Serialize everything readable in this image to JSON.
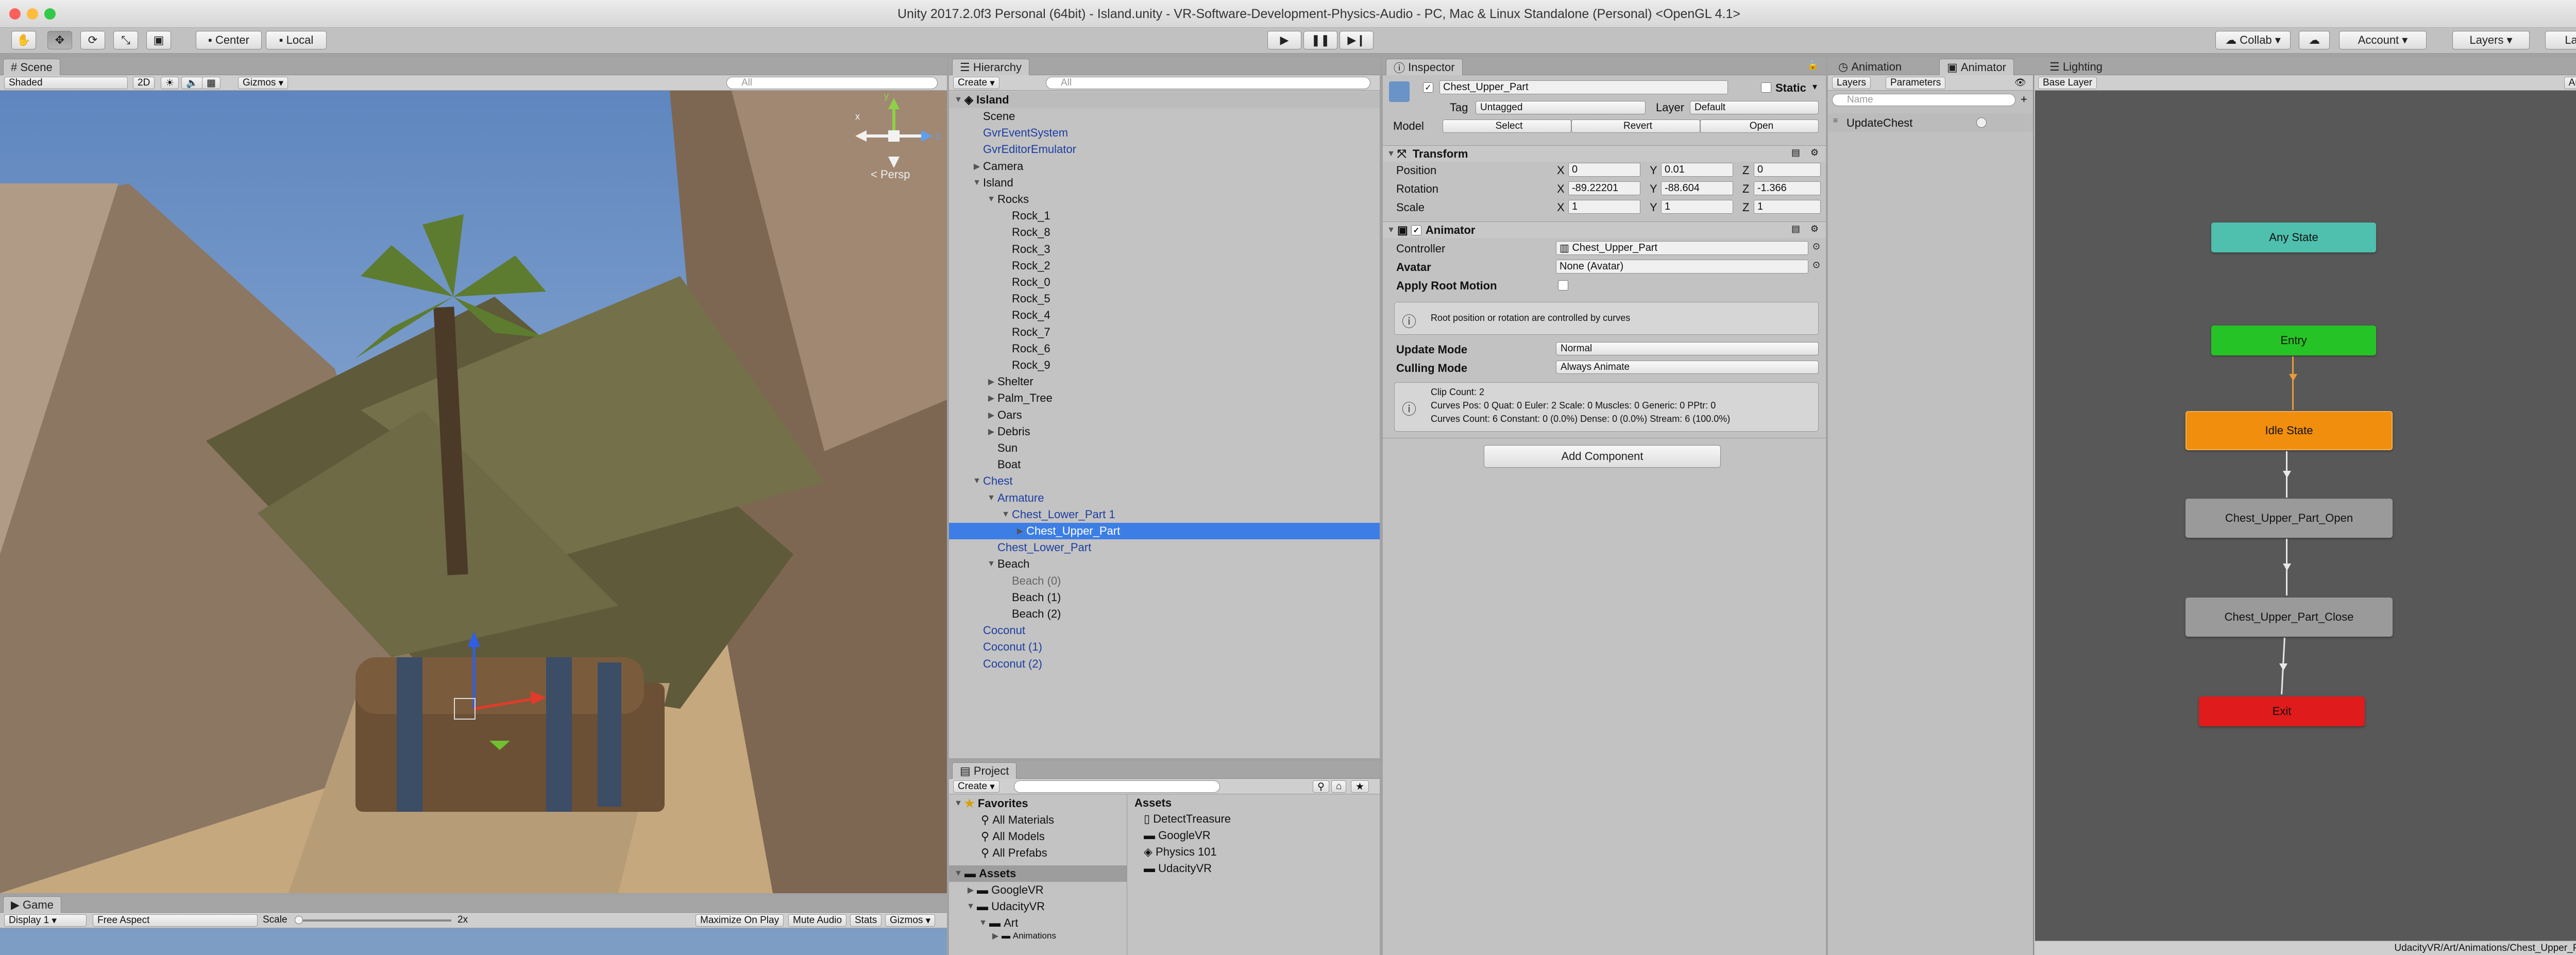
{
  "window": {
    "title": "Unity 2017.2.0f3 Personal (64bit) - Island.unity - VR-Software-Development-Physics-Audio - PC, Mac & Linux Standalone (Personal) <OpenGL 4.1>"
  },
  "toolbar": {
    "pivot": "Center",
    "space": "Local",
    "collab": "Collab",
    "account": "Account",
    "layers": "Layers",
    "layout": "Layout"
  },
  "scene": {
    "tab": "Scene",
    "shading": "Shaded",
    "mode_2d": "2D",
    "gizmos": "Gizmos",
    "search_placeholder": "All",
    "persp": "Persp",
    "axes": {
      "x": "x",
      "y": "y",
      "z": "z"
    }
  },
  "game": {
    "tab": "Game",
    "display": "Display 1",
    "aspect": "Free Aspect",
    "scale_label": "Scale",
    "scale_value": "2x",
    "maximize": "Maximize On Play",
    "mute": "Mute Audio",
    "stats": "Stats",
    "gizmos": "Gizmos"
  },
  "hierarchy": {
    "tab": "Hierarchy",
    "create": "Create",
    "search_placeholder": "All",
    "scene_root": "Island",
    "items": [
      {
        "label": "Scene",
        "color": "#111111"
      },
      {
        "label": "GvrEventSystem",
        "color": "#1d3ea0"
      },
      {
        "label": "GvrEditorEmulator",
        "color": "#1d3ea0"
      },
      {
        "label": "Camera",
        "color": "#111111"
      },
      {
        "label": "Island",
        "color": "#111111"
      },
      {
        "label": "Rocks",
        "color": "#111111"
      },
      {
        "label": "Rock_1",
        "color": "#111111"
      },
      {
        "label": "Rock_8",
        "color": "#111111"
      },
      {
        "label": "Rock_3",
        "color": "#111111"
      },
      {
        "label": "Rock_2",
        "color": "#111111"
      },
      {
        "label": "Rock_0",
        "color": "#111111"
      },
      {
        "label": "Rock_5",
        "color": "#111111"
      },
      {
        "label": "Rock_4",
        "color": "#111111"
      },
      {
        "label": "Rock_7",
        "color": "#111111"
      },
      {
        "label": "Rock_6",
        "color": "#111111"
      },
      {
        "label": "Rock_9",
        "color": "#111111"
      },
      {
        "label": "Shelter",
        "color": "#111111"
      },
      {
        "label": "Palm_Tree",
        "color": "#111111"
      },
      {
        "label": "Oars",
        "color": "#111111"
      },
      {
        "label": "Debris",
        "color": "#111111"
      },
      {
        "label": "Sun",
        "color": "#111111"
      },
      {
        "label": "Boat",
        "color": "#111111"
      },
      {
        "label": "Chest",
        "color": "#1d3ea0"
      },
      {
        "label": "Armature",
        "color": "#1d3ea0"
      },
      {
        "label": "Chest_Lower_Part 1",
        "color": "#1d3ea0"
      },
      {
        "label": "Chest_Upper_Part",
        "color": "#9bbdf2"
      },
      {
        "label": "Chest_Lower_Part",
        "color": "#1d3ea0"
      },
      {
        "label": "Beach",
        "color": "#111111"
      },
      {
        "label": "Beach (0)",
        "color": "#666666"
      },
      {
        "label": "Beach (1)",
        "color": "#111111"
      },
      {
        "label": "Beach (2)",
        "color": "#111111"
      },
      {
        "label": "Coconut",
        "color": "#1d3ea0"
      },
      {
        "label": "Coconut (1)",
        "color": "#1d3ea0"
      },
      {
        "label": "Coconut (2)",
        "color": "#1d3ea0"
      }
    ]
  },
  "project": {
    "tab": "Project",
    "create": "Create",
    "favorites": "Favorites",
    "favorite_items": [
      "All Materials",
      "All Models",
      "All Prefabs"
    ],
    "assets_root": "Assets",
    "tree": [
      "GoogleVR",
      "UdacityVR",
      "Art",
      "Animations"
    ],
    "assets_header": "Assets",
    "asset_items": [
      "DetectTreasure",
      "GoogleVR",
      "Physics 101",
      "UdacityVR"
    ]
  },
  "inspector": {
    "tab": "Inspector",
    "object_name": "Chest_Upper_Part",
    "static_label": "Static",
    "tag_label": "Tag",
    "tag_value": "Untagged",
    "layer_label": "Layer",
    "layer_value": "Default",
    "model_label": "Model",
    "select": "Select",
    "revert": "Revert",
    "open": "Open",
    "transform": {
      "title": "Transform",
      "position_label": "Position",
      "position": {
        "x": "0",
        "y": "0.01",
        "z": "0"
      },
      "rotation_label": "Rotation",
      "rotation": {
        "x": "-89.22201",
        "y": "-88.604",
        "z": "-1.366"
      },
      "scale_label": "Scale",
      "scale": {
        "x": "1",
        "y": "1",
        "z": "1"
      },
      "x": "X",
      "y": "Y",
      "z": "Z"
    },
    "animator": {
      "title": "Animator",
      "controller_label": "Controller",
      "controller_value": "Chest_Upper_Part",
      "avatar_label": "Avatar",
      "avatar_value": "None (Avatar)",
      "root_motion_label": "Apply Root Motion",
      "root_motion_note": "Root position or rotation are controlled by curves",
      "update_mode_label": "Update Mode",
      "update_mode_value": "Normal",
      "culling_mode_label": "Culling Mode",
      "culling_mode_value": "Always Animate",
      "clip_info": [
        "Clip Count: 2",
        "Curves Pos: 0 Quat: 0 Euler: 2 Scale: 0 Muscles: 0 Generic: 0 PPtr: 0",
        "Curves Count: 6 Constant: 0 (0.0%) Dense: 0 (0.0%) Stream: 6 (100.0%)"
      ]
    },
    "add_component": "Add Component"
  },
  "animator_window": {
    "tabs": [
      "Animation",
      "Animator",
      "Lighting"
    ],
    "layers_tab": "Layers",
    "parameters_tab": "Parameters",
    "search_placeholder": "Name",
    "parameters": [
      "UpdateChest"
    ],
    "base_layer": "Base Layer",
    "auto_live_link": "Auto Live Link",
    "states": [
      {
        "label": "Any State",
        "color": "#4fbfae"
      },
      {
        "label": "Entry",
        "color": "#25c325"
      },
      {
        "label": "Idle State",
        "color": "#f18e0e"
      },
      {
        "label": "Chest_Upper_Part_Open",
        "color": "#9a9a9a"
      },
      {
        "label": "Chest_Upper_Part_Close",
        "color": "#9a9a9a"
      },
      {
        "label": "Exit",
        "color": "#e01b1b"
      }
    ],
    "status_path": "UdacityVR/Art/Animations/Chest_Upper_Part.controller"
  }
}
